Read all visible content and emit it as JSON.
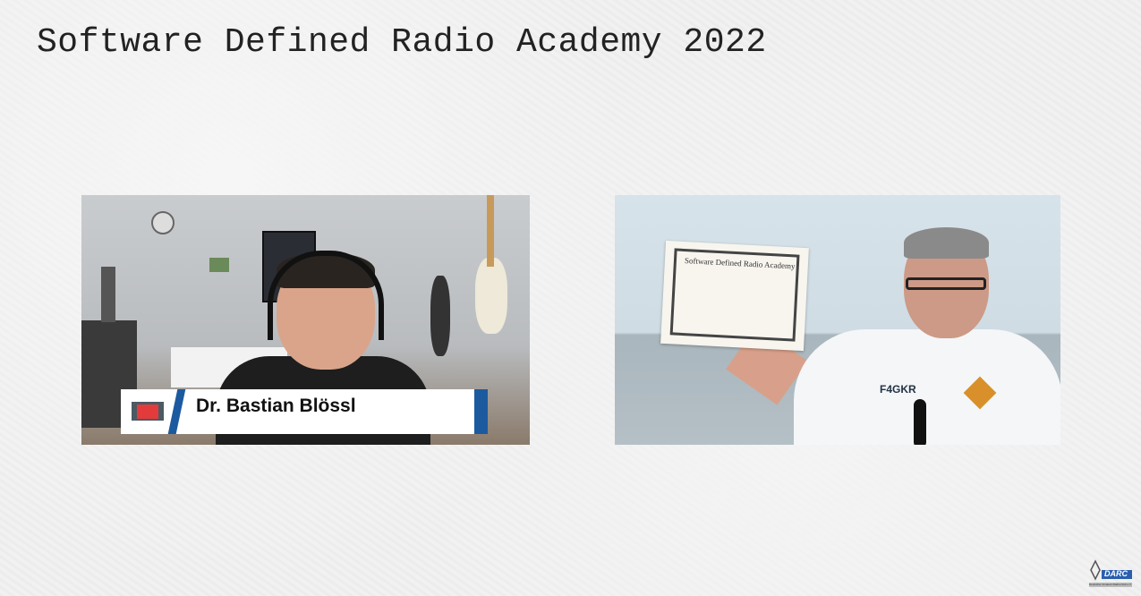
{
  "slide": {
    "title": "Software Defined Radio Academy 2022"
  },
  "left_video": {
    "speaker_name": "Dr. Bastian Blössl",
    "plate_logo": "HAM RADIO"
  },
  "right_video": {
    "certificate_title": "Software Defined Radio Academy",
    "shirt_text": "F4GKR"
  },
  "footer": {
    "logo_text": "DARC",
    "logo_subtext": "Deutscher Amateur-Radio-Club e.V."
  }
}
